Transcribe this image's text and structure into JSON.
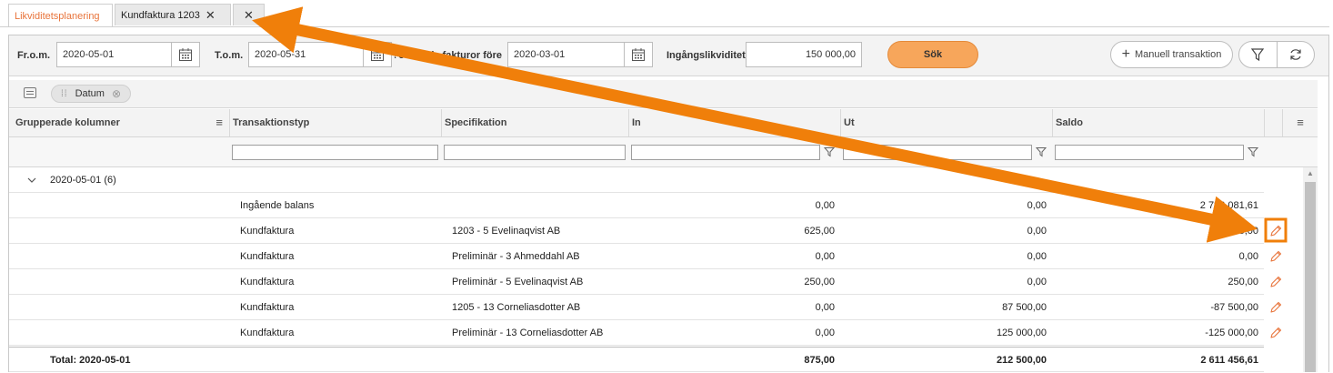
{
  "tabs": [
    {
      "label": "Likviditetsplanering",
      "color": "#e8743b"
    },
    {
      "label": "Kundfaktura 1203"
    },
    {
      "label": ""
    }
  ],
  "toolbar": {
    "from_label": "Fr.o.m.",
    "from_value": "2020-05-01",
    "to_label": "T.o.m.",
    "to_value": "2020-05-31",
    "exclude_label": "Exkludera obetalda fakturor före",
    "exclude_value": "2020-03-01",
    "opening_label": "Ingångslikviditet",
    "opening_value": "150 000,00",
    "search_label": "Sök",
    "manual_label": "Manuell transaktion"
  },
  "groupbar": {
    "chip_label": "Datum"
  },
  "columns": {
    "grouped": "Grupperade kolumner",
    "type": "Transaktionstyp",
    "spec": "Specifikation",
    "in": "In",
    "out": "Ut",
    "balance": "Saldo"
  },
  "group": {
    "label": "2020-05-01 (6)"
  },
  "rows": [
    {
      "type": "Ingående balans",
      "spec": "",
      "in": "0,00",
      "out": "0,00",
      "balance": "2 783 081,61",
      "editable": false
    },
    {
      "type": "Kundfaktura",
      "spec": "1203 - 5 Evelinaqvist AB",
      "in": "625,00",
      "out": "0,00",
      "balance": "625,00",
      "editable": true
    },
    {
      "type": "Kundfaktura",
      "spec": "Preliminär - 3 Ahmeddahl AB",
      "in": "0,00",
      "out": "0,00",
      "balance": "0,00",
      "editable": true
    },
    {
      "type": "Kundfaktura",
      "spec": "Preliminär - 5 Evelinaqvist AB",
      "in": "250,00",
      "out": "0,00",
      "balance": "250,00",
      "editable": true
    },
    {
      "type": "Kundfaktura",
      "spec": "1205 - 13 Corneliasdotter AB",
      "in": "0,00",
      "out": "87 500,00",
      "balance": "-87 500,00",
      "editable": true
    },
    {
      "type": "Kundfaktura",
      "spec": "Preliminär - 13 Corneliasdotter AB",
      "in": "0,00",
      "out": "125 000,00",
      "balance": "-125 000,00",
      "editable": true
    }
  ],
  "total": {
    "label": "Total: 2020-05-01",
    "in": "875,00",
    "out": "212 500,00",
    "balance": "2 611 456,61"
  },
  "colors": {
    "accent": "#f7a65b",
    "annotation": "#f07f0a",
    "pencil": "#e8743b"
  }
}
